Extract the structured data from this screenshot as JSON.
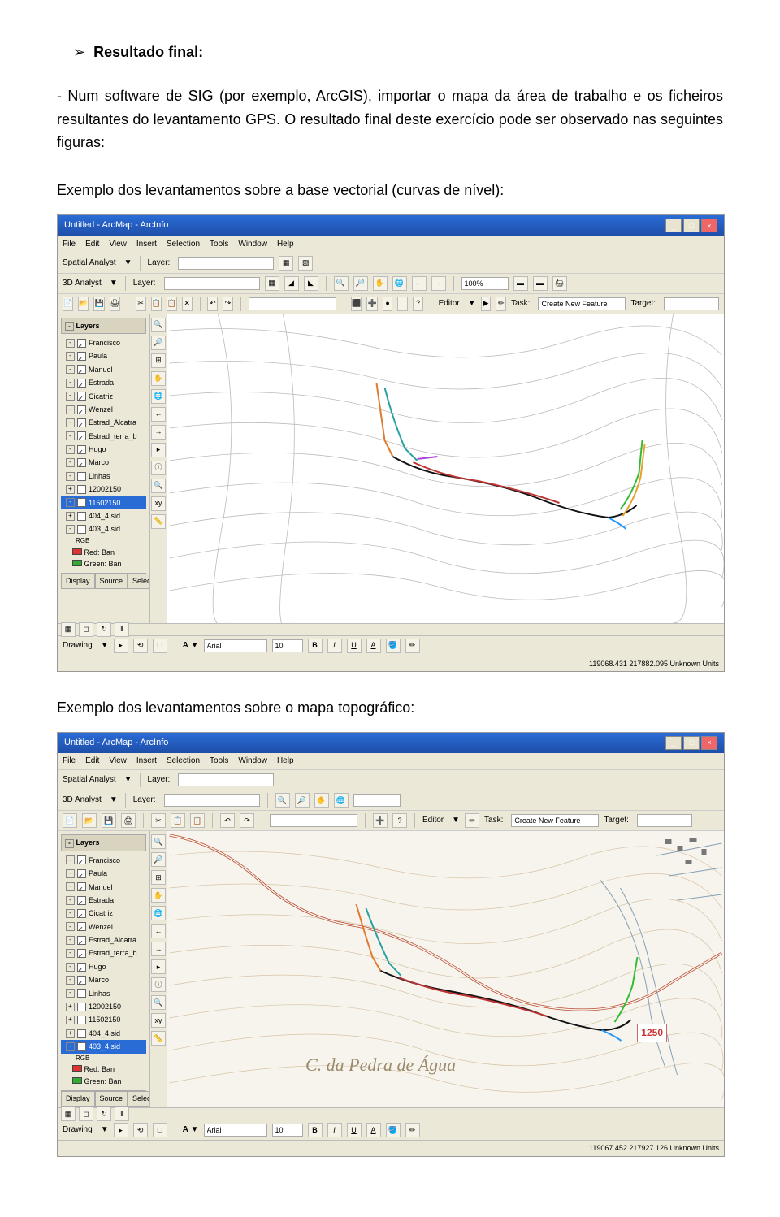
{
  "heading": "Resultado final:",
  "para1": "- Num software de SIG (por exemplo, ArcGIS), importar o mapa da área de trabalho e os ficheiros resultantes do levantamento GPS. O resultado final deste exercício pode ser observado nas seguintes figuras:",
  "para2": "Exemplo dos levantamentos sobre a base vectorial (curvas de nível):",
  "para3": "Exemplo dos levantamentos sobre o mapa topográfico:",
  "app": {
    "title": "Untitled - ArcMap - ArcInfo",
    "menus": [
      "File",
      "Edit",
      "View",
      "Insert",
      "Selection",
      "Tools",
      "Window",
      "Help"
    ],
    "spatial_label": "Spatial Analyst",
    "analyst3d_label": "3D Analyst",
    "layer_label": "Layer:",
    "editor_label": "Editor",
    "task_label": "Task:",
    "task_value": "Create New Feature",
    "target_label": "Target:",
    "drawing_label": "Drawing",
    "font_name": "Arial",
    "font_size": "10",
    "layers_header": "Layers",
    "layers": [
      "Francisco",
      "Paula",
      "Manuel",
      "Estrada",
      "Cicatriz",
      "Wenzel",
      "Estrad_Alcatra",
      "Estrad_terra_b",
      "Hugo",
      "Marco",
      "Linhas",
      "12002150",
      "11502150",
      "404_4.sid",
      "403_4.sid"
    ],
    "selected_layer1": "11502150",
    "selected_layer2": "403_4.sid",
    "rgb_label": "RGB",
    "red_label": "Red: Ban",
    "green_label": "Green: Ban",
    "tabs": [
      "Display",
      "Source",
      "Selection"
    ],
    "status1": "119068.431 217882.095 Unknown Units",
    "status2": "119067.452 217927.126 Unknown Units",
    "scale": "100%",
    "map_label": "C. da Pedra de Água",
    "elevation_marker": "1250"
  }
}
